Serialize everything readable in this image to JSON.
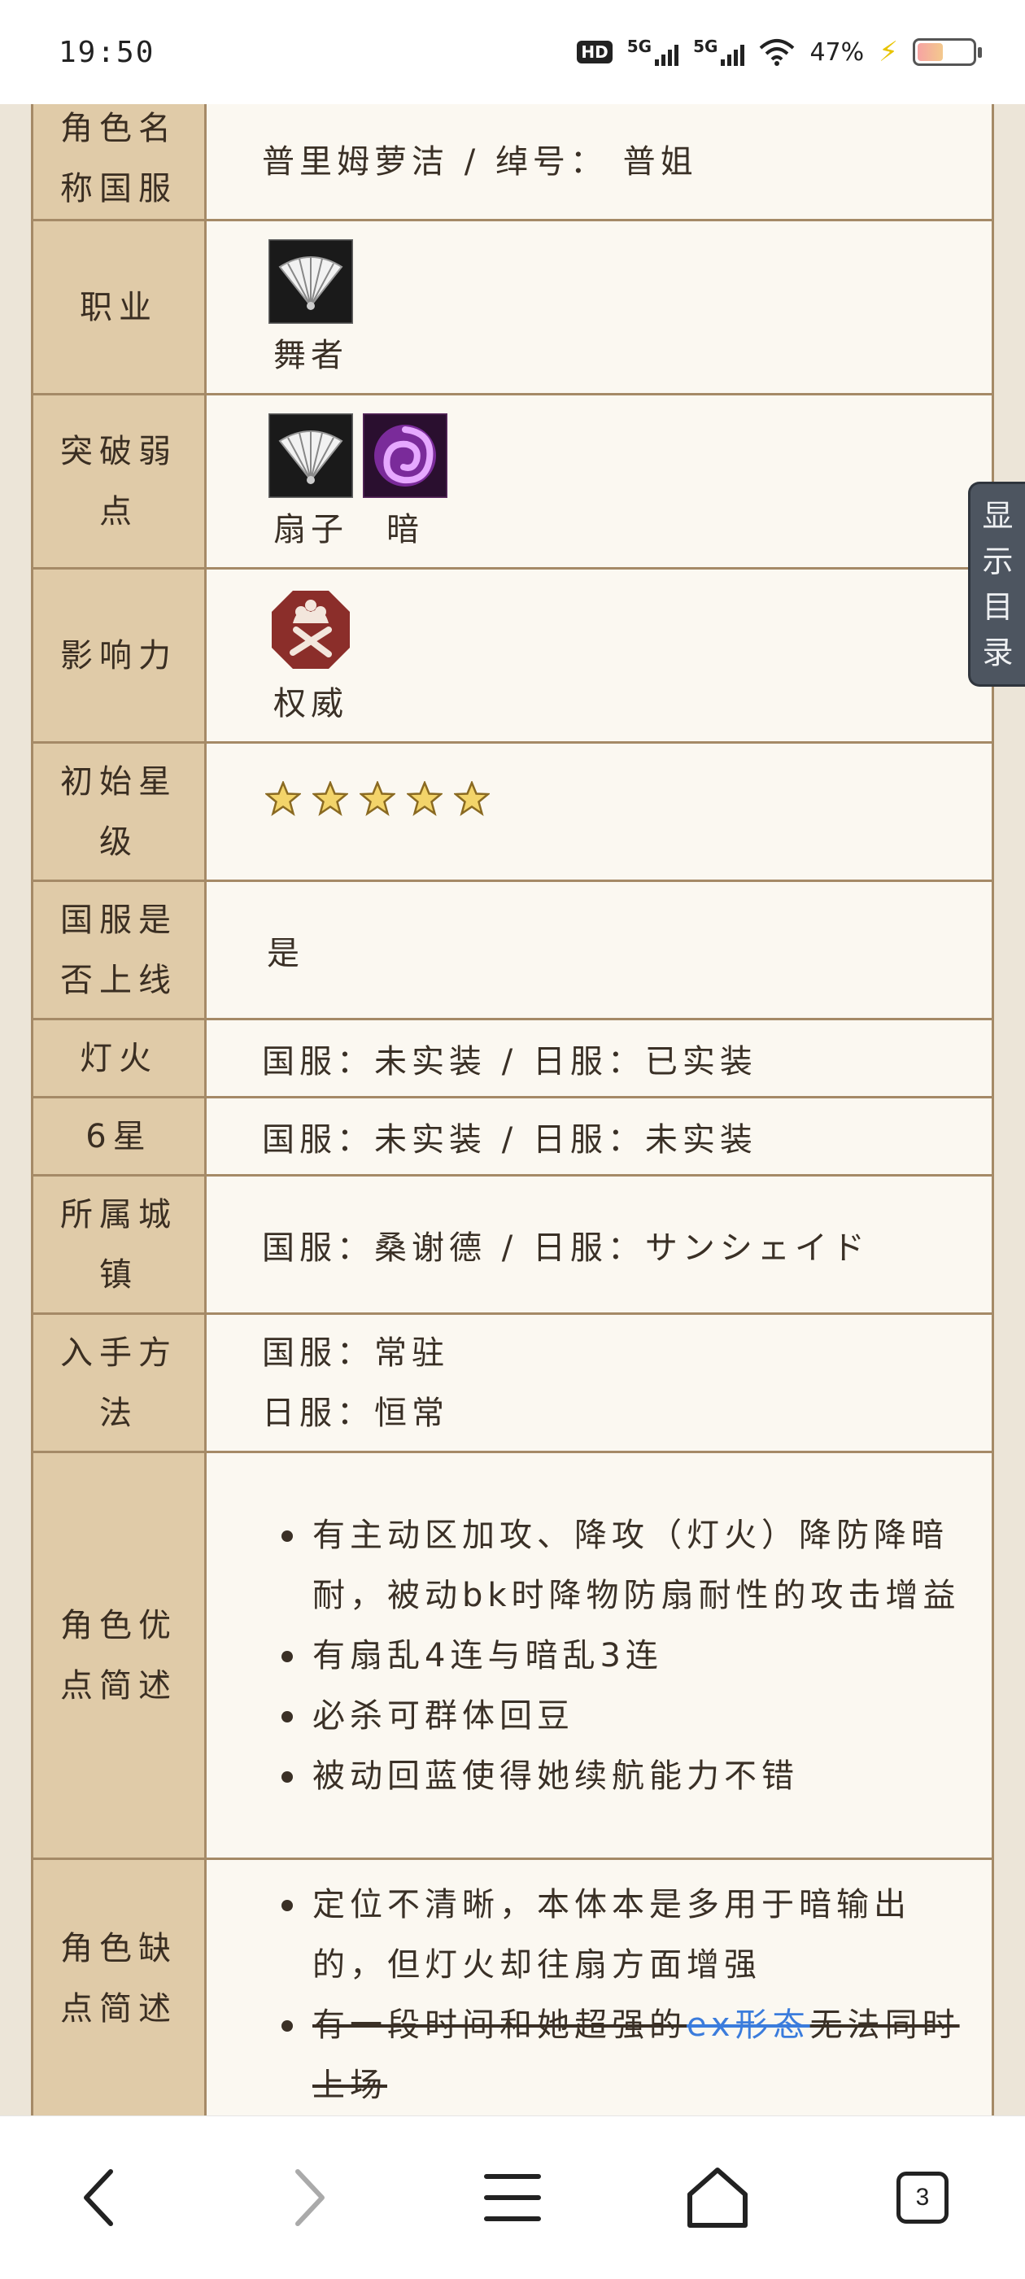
{
  "status_bar": {
    "time": "19:50",
    "hd_label": "HD",
    "network_1": "5G",
    "network_2": "5G",
    "battery_percent": "47%",
    "battery_level": 0.47
  },
  "toc_tab": {
    "label": [
      "显",
      "示",
      "目",
      "录"
    ]
  },
  "rows": {
    "name": {
      "key_line1": "角色名",
      "key_line2": "称国服",
      "value": "普里姆萝洁 / 绰号： 普姐"
    },
    "job": {
      "key": "职业",
      "icon": "fan-icon",
      "caption": "舞者"
    },
    "weakness": {
      "key_line1": "突破弱",
      "key_line2": "点",
      "icon1": "fan-icon",
      "icon2": "dark-swirl-icon",
      "caption1": "扇子",
      "caption2": "暗"
    },
    "influence": {
      "key": "影响力",
      "icon": "authority-crest-icon",
      "caption": "权威"
    },
    "stars": {
      "key_line1": "初始星",
      "key_line2": "级",
      "count": 5
    },
    "cn_online": {
      "key_line1": "国服是",
      "key_line2": "否上线",
      "value": "是"
    },
    "lamp": {
      "key": "灯火",
      "value": "国服：未实装 / 日服：已实装"
    },
    "six_star": {
      "key": "6星",
      "value": "国服：未实装 / 日服：未实装"
    },
    "town": {
      "key_line1": "所属城",
      "key_line2": "镇",
      "value": "国服：桑谢德 / 日服：サンシェイド"
    },
    "obtain": {
      "key_line1": "入手方",
      "key_line2": "法",
      "value_line1": "国服：常驻",
      "value_line2": "日服：恒常"
    },
    "pros": {
      "key_line1": "角色优",
      "key_line2": "点简述",
      "points": [
        "有主动区加攻、降攻（灯火）降防降暗耐，被动bk时降物防扇耐性的攻击增益",
        "有扇乱4连与暗乱3连",
        "必杀可群体回豆",
        "被动回蓝使得她续航能力不错"
      ]
    },
    "cons": {
      "key_line1": "角色缺",
      "key_line2": "点简述",
      "point1": "定位不清晰，本体本是多用于暗输出的，但灯火却往扇方面增强",
      "point2_before": "有一段时间和她超强的",
      "point2_link": "ex形态",
      "point2_after": "无法同时上场"
    }
  },
  "bottom_nav": {
    "tab_count": "3"
  },
  "colors": {
    "key_bg": "#e0cba8",
    "value_bg": "#fbf8f1",
    "border": "#a58a67",
    "link": "#3b7cdc"
  }
}
